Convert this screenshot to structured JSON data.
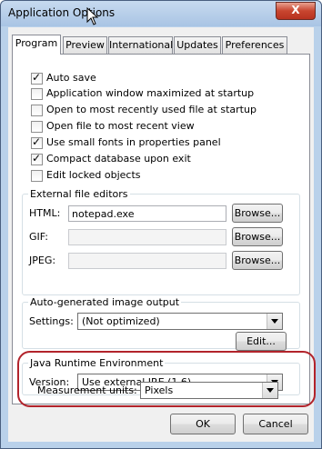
{
  "window": {
    "title": "Application Options",
    "close_symbol": "X"
  },
  "tabs": [
    {
      "label": "Program",
      "active": true
    },
    {
      "label": "Preview",
      "active": false
    },
    {
      "label": "International",
      "active": false
    },
    {
      "label": "Updates",
      "active": false
    },
    {
      "label": "Preferences",
      "active": false
    }
  ],
  "checkboxes": [
    {
      "label": "Auto save",
      "checked": true
    },
    {
      "label": "Application window maximized at startup",
      "checked": false
    },
    {
      "label": "Open to most recently used file at startup",
      "checked": false
    },
    {
      "label": "Open file to most recent view",
      "checked": false
    },
    {
      "label": "Use small fonts in properties panel",
      "checked": true
    },
    {
      "label": "Compact database upon exit",
      "checked": true
    },
    {
      "label": "Edit locked objects",
      "checked": false
    }
  ],
  "check_mark": "✓",
  "editors": {
    "title": "External file editors",
    "html_label": "HTML:",
    "html_value": "notepad.exe",
    "gif_label": "GIF:",
    "gif_value": "",
    "jpeg_label": "JPEG:",
    "jpeg_value": "",
    "browse_label": "Browse..."
  },
  "image_output": {
    "title": "Auto-generated image output",
    "settings_label": "Settings:",
    "settings_value": "(Not optimized)",
    "edit_label": "Edit..."
  },
  "jre": {
    "title": "Java Runtime Environment",
    "version_label": "Version:",
    "version_value": "Use external JRE (1.6)"
  },
  "measurement": {
    "label": "Measurement units:",
    "value": "Pixels"
  },
  "footer": {
    "ok_label": "OK",
    "cancel_label": "Cancel"
  },
  "colors": {
    "highlight": "#b2232b",
    "title_bar": "#b9d1ea",
    "close_button": "#c8452f"
  }
}
